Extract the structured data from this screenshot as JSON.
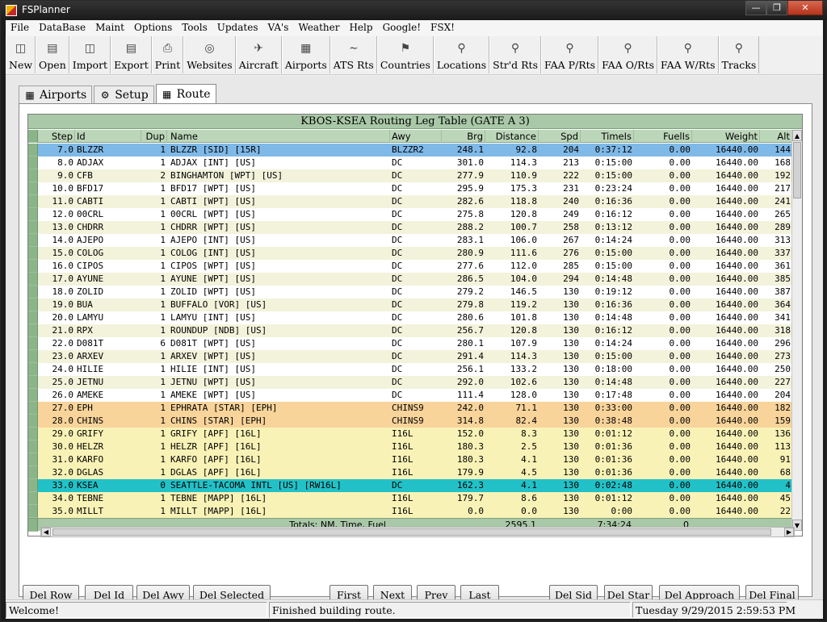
{
  "window": {
    "title": "FSPlanner"
  },
  "menu": [
    "File",
    "DataBase",
    "Maint",
    "Options",
    "Tools",
    "Updates",
    "VA's",
    "Weather",
    "Help",
    "Google!",
    "FSX!"
  ],
  "toolbar": [
    {
      "label": "New",
      "icon": "new-icon"
    },
    {
      "label": "Open",
      "icon": "open-icon"
    },
    {
      "label": "Import",
      "icon": "import-icon"
    },
    {
      "label": "Export",
      "icon": "export-icon"
    },
    {
      "label": "Print",
      "icon": "print-icon"
    },
    {
      "label": "Websites",
      "icon": "websites-icon"
    },
    {
      "label": "Aircraft",
      "icon": "aircraft-icon"
    },
    {
      "label": "Airports",
      "icon": "airports-icon"
    },
    {
      "label": "ATS Rts",
      "icon": "ats-routes-icon"
    },
    {
      "label": "Countries",
      "icon": "countries-icon"
    },
    {
      "label": "Locations",
      "icon": "locations-icon"
    },
    {
      "label": "Str'd Rts",
      "icon": "stored-routes-icon"
    },
    {
      "label": "FAA P/Rts",
      "icon": "faa-preferred-routes-icon"
    },
    {
      "label": "FAA O/Rts",
      "icon": "faa-other-routes-icon"
    },
    {
      "label": "FAA W/Rts",
      "icon": "faa-weather-routes-icon"
    },
    {
      "label": "Tracks",
      "icon": "tracks-icon"
    }
  ],
  "tabs": [
    {
      "label": "Airports",
      "icon": "airports-tab-icon",
      "active": false
    },
    {
      "label": "Setup",
      "icon": "setup-tab-icon",
      "active": false
    },
    {
      "label": "Route",
      "icon": "route-tab-icon",
      "active": true
    }
  ],
  "table": {
    "title": "KBOS-KSEA Routing Leg Table (GATE A 3)",
    "columns": [
      "Step",
      "Id",
      "Dup",
      "Name",
      "Awy",
      "Brg",
      "Distance",
      "Spd",
      "TimeIs",
      "FuelIs",
      "Weight",
      "Alt"
    ],
    "rows": [
      {
        "step": "7.0",
        "id": "BLZZR",
        "dup": "1",
        "name": "BLZZR [SID] [15R]",
        "awy": "BLZZR2",
        "brg": "248.1",
        "dist": "92.8",
        "spd": "204",
        "time": "0:37:12",
        "fuel": "0.00",
        "weight": "16440.00",
        "alt": "144",
        "style": "selected"
      },
      {
        "step": "8.0",
        "id": "ADJAX",
        "dup": "1",
        "name": "ADJAX [INT] [US]",
        "awy": "DC",
        "brg": "301.0",
        "dist": "114.3",
        "spd": "213",
        "time": "0:15:00",
        "fuel": "0.00",
        "weight": "16440.00",
        "alt": "168",
        "style": "white"
      },
      {
        "step": "9.0",
        "id": "CFB",
        "dup": "2",
        "name": "BINGHAMTON [WPT] [US]",
        "awy": "DC",
        "brg": "277.9",
        "dist": "110.9",
        "spd": "222",
        "time": "0:15:00",
        "fuel": "0.00",
        "weight": "16440.00",
        "alt": "192",
        "style": "cream"
      },
      {
        "step": "10.0",
        "id": "BFD17",
        "dup": "1",
        "name": "BFD17 [WPT] [US]",
        "awy": "DC",
        "brg": "295.9",
        "dist": "175.3",
        "spd": "231",
        "time": "0:23:24",
        "fuel": "0.00",
        "weight": "16440.00",
        "alt": "217",
        "style": "white"
      },
      {
        "step": "11.0",
        "id": "CABTI",
        "dup": "1",
        "name": "CABTI [WPT] [US]",
        "awy": "DC",
        "brg": "282.6",
        "dist": "118.8",
        "spd": "240",
        "time": "0:16:36",
        "fuel": "0.00",
        "weight": "16440.00",
        "alt": "241",
        "style": "cream"
      },
      {
        "step": "12.0",
        "id": "00CRL",
        "dup": "1",
        "name": "00CRL [WPT] [US]",
        "awy": "DC",
        "brg": "275.8",
        "dist": "120.8",
        "spd": "249",
        "time": "0:16:12",
        "fuel": "0.00",
        "weight": "16440.00",
        "alt": "265",
        "style": "white"
      },
      {
        "step": "13.0",
        "id": "CHDRR",
        "dup": "1",
        "name": "CHDRR [WPT] [US]",
        "awy": "DC",
        "brg": "288.2",
        "dist": "100.7",
        "spd": "258",
        "time": "0:13:12",
        "fuel": "0.00",
        "weight": "16440.00",
        "alt": "289",
        "style": "cream"
      },
      {
        "step": "14.0",
        "id": "AJEPO",
        "dup": "1",
        "name": "AJEPO [INT] [US]",
        "awy": "DC",
        "brg": "283.1",
        "dist": "106.0",
        "spd": "267",
        "time": "0:14:24",
        "fuel": "0.00",
        "weight": "16440.00",
        "alt": "313",
        "style": "white"
      },
      {
        "step": "15.0",
        "id": "COLOG",
        "dup": "1",
        "name": "COLOG [INT] [US]",
        "awy": "DC",
        "brg": "280.9",
        "dist": "111.6",
        "spd": "276",
        "time": "0:15:00",
        "fuel": "0.00",
        "weight": "16440.00",
        "alt": "337",
        "style": "cream"
      },
      {
        "step": "16.0",
        "id": "CIPOS",
        "dup": "1",
        "name": "CIPOS [WPT] [US]",
        "awy": "DC",
        "brg": "277.6",
        "dist": "112.0",
        "spd": "285",
        "time": "0:15:00",
        "fuel": "0.00",
        "weight": "16440.00",
        "alt": "361",
        "style": "white"
      },
      {
        "step": "17.0",
        "id": "AYUNE",
        "dup": "1",
        "name": "AYUNE [WPT] [US]",
        "awy": "DC",
        "brg": "286.5",
        "dist": "104.0",
        "spd": "294",
        "time": "0:14:48",
        "fuel": "0.00",
        "weight": "16440.00",
        "alt": "385",
        "style": "cream"
      },
      {
        "step": "18.0",
        "id": "ZOLID",
        "dup": "1",
        "name": "ZOLID [WPT] [US]",
        "awy": "DC",
        "brg": "279.2",
        "dist": "146.5",
        "spd": "130",
        "time": "0:19:12",
        "fuel": "0.00",
        "weight": "16440.00",
        "alt": "387",
        "style": "white"
      },
      {
        "step": "19.0",
        "id": "BUA",
        "dup": "1",
        "name": "BUFFALO [VOR] [US]",
        "awy": "DC",
        "brg": "279.8",
        "dist": "119.2",
        "spd": "130",
        "time": "0:16:36",
        "fuel": "0.00",
        "weight": "16440.00",
        "alt": "364",
        "style": "cream"
      },
      {
        "step": "20.0",
        "id": "LAMYU",
        "dup": "1",
        "name": "LAMYU [INT] [US]",
        "awy": "DC",
        "brg": "280.6",
        "dist": "101.8",
        "spd": "130",
        "time": "0:14:48",
        "fuel": "0.00",
        "weight": "16440.00",
        "alt": "341",
        "style": "white"
      },
      {
        "step": "21.0",
        "id": "RPX",
        "dup": "1",
        "name": "ROUNDUP [NDB] [US]",
        "awy": "DC",
        "brg": "256.7",
        "dist": "120.8",
        "spd": "130",
        "time": "0:16:12",
        "fuel": "0.00",
        "weight": "16440.00",
        "alt": "318",
        "style": "cream"
      },
      {
        "step": "22.0",
        "id": "D081T",
        "dup": "6",
        "name": "D081T [WPT] [US]",
        "awy": "DC",
        "brg": "280.1",
        "dist": "107.9",
        "spd": "130",
        "time": "0:14:24",
        "fuel": "0.00",
        "weight": "16440.00",
        "alt": "296",
        "style": "white"
      },
      {
        "step": "23.0",
        "id": "ARXEV",
        "dup": "1",
        "name": "ARXEV [WPT] [US]",
        "awy": "DC",
        "brg": "291.4",
        "dist": "114.3",
        "spd": "130",
        "time": "0:15:00",
        "fuel": "0.00",
        "weight": "16440.00",
        "alt": "273",
        "style": "cream"
      },
      {
        "step": "24.0",
        "id": "HILIE",
        "dup": "1",
        "name": "HILIE [INT] [US]",
        "awy": "DC",
        "brg": "256.1",
        "dist": "133.2",
        "spd": "130",
        "time": "0:18:00",
        "fuel": "0.00",
        "weight": "16440.00",
        "alt": "250",
        "style": "white"
      },
      {
        "step": "25.0",
        "id": "JETNU",
        "dup": "1",
        "name": "JETNU [WPT] [US]",
        "awy": "DC",
        "brg": "292.0",
        "dist": "102.6",
        "spd": "130",
        "time": "0:14:48",
        "fuel": "0.00",
        "weight": "16440.00",
        "alt": "227",
        "style": "cream"
      },
      {
        "step": "26.0",
        "id": "AMEKE",
        "dup": "1",
        "name": "AMEKE [WPT] [US]",
        "awy": "DC",
        "brg": "111.4",
        "dist": "128.0",
        "spd": "130",
        "time": "0:17:48",
        "fuel": "0.00",
        "weight": "16440.00",
        "alt": "204",
        "style": "white"
      },
      {
        "step": "27.0",
        "id": "EPH",
        "dup": "1",
        "name": "EPHRATA [STAR] [EPH]",
        "awy": "CHINS9",
        "brg": "242.0",
        "dist": "71.1",
        "spd": "130",
        "time": "0:33:00",
        "fuel": "0.00",
        "weight": "16440.00",
        "alt": "182",
        "style": "orange"
      },
      {
        "step": "28.0",
        "id": "CHINS",
        "dup": "1",
        "name": "CHINS [STAR] [EPH]",
        "awy": "CHINS9",
        "brg": "314.8",
        "dist": "82.4",
        "spd": "130",
        "time": "0:38:48",
        "fuel": "0.00",
        "weight": "16440.00",
        "alt": "159",
        "style": "orange"
      },
      {
        "step": "29.0",
        "id": "GRIFY",
        "dup": "1",
        "name": "GRIFY [APF] [16L]",
        "awy": "I16L",
        "brg": "152.0",
        "dist": "8.3",
        "spd": "130",
        "time": "0:01:12",
        "fuel": "0.00",
        "weight": "16440.00",
        "alt": "136",
        "style": "yellow"
      },
      {
        "step": "30.0",
        "id": "HELZR",
        "dup": "1",
        "name": "HELZR [APF] [16L]",
        "awy": "I16L",
        "brg": "180.3",
        "dist": "2.5",
        "spd": "130",
        "time": "0:01:36",
        "fuel": "0.00",
        "weight": "16440.00",
        "alt": "113",
        "style": "yellow"
      },
      {
        "step": "31.0",
        "id": "KARFO",
        "dup": "1",
        "name": "KARFO [APF] [16L]",
        "awy": "I16L",
        "brg": "180.3",
        "dist": "4.1",
        "spd": "130",
        "time": "0:01:36",
        "fuel": "0.00",
        "weight": "16440.00",
        "alt": "91",
        "style": "yellow"
      },
      {
        "step": "32.0",
        "id": "DGLAS",
        "dup": "1",
        "name": "DGLAS [APF] [16L]",
        "awy": "I16L",
        "brg": "179.9",
        "dist": "4.5",
        "spd": "130",
        "time": "0:01:36",
        "fuel": "0.00",
        "weight": "16440.00",
        "alt": "68",
        "style": "yellow"
      },
      {
        "step": "33.0",
        "id": "KSEA",
        "dup": "0",
        "name": "SEATTLE-TACOMA INTL [US] [RW16L]",
        "awy": "DC",
        "brg": "162.3",
        "dist": "4.1",
        "spd": "130",
        "time": "0:02:48",
        "fuel": "0.00",
        "weight": "16440.00",
        "alt": "4",
        "style": "teal"
      },
      {
        "step": "34.0",
        "id": "TEBNE",
        "dup": "1",
        "name": "TEBNE [MAPP] [16L]",
        "awy": "I16L",
        "brg": "179.7",
        "dist": "8.6",
        "spd": "130",
        "time": "0:01:12",
        "fuel": "0.00",
        "weight": "16440.00",
        "alt": "45",
        "style": "yellow"
      },
      {
        "step": "35.0",
        "id": "MILLT",
        "dup": "1",
        "name": "MILLT [MAPP] [16L]",
        "awy": "I16L",
        "brg": "0.0",
        "dist": "0.0",
        "spd": "130",
        "time": "0:00",
        "fuel": "0.00",
        "weight": "16440.00",
        "alt": "22",
        "style": "yellow"
      }
    ],
    "totals": {
      "label": "Totals: NM, Time, Fuel",
      "distance": "2595.1",
      "time": "7:34:24",
      "fuel": "0"
    }
  },
  "buttons_left": [
    "Del Row",
    "Del Id",
    "Del Awy",
    "Del Selected"
  ],
  "buttons_nav": [
    "First",
    "Next",
    "Prev",
    "Last"
  ],
  "buttons_right": [
    "Del Sid",
    "Del Star",
    "Del Approach",
    "Del Final"
  ],
  "status": {
    "left": "Welcome!",
    "middle": "Finished building route.",
    "right": "Tuesday 9/29/2015 2:59:53 PM"
  },
  "colors": {
    "selected": "#7fb9e8",
    "white": "#ffffff",
    "cream": "#f3f3dc",
    "orange": "#f8d49a",
    "yellow": "#f9f2b6",
    "teal": "#22c1c7",
    "header": "#bcd6b9"
  }
}
